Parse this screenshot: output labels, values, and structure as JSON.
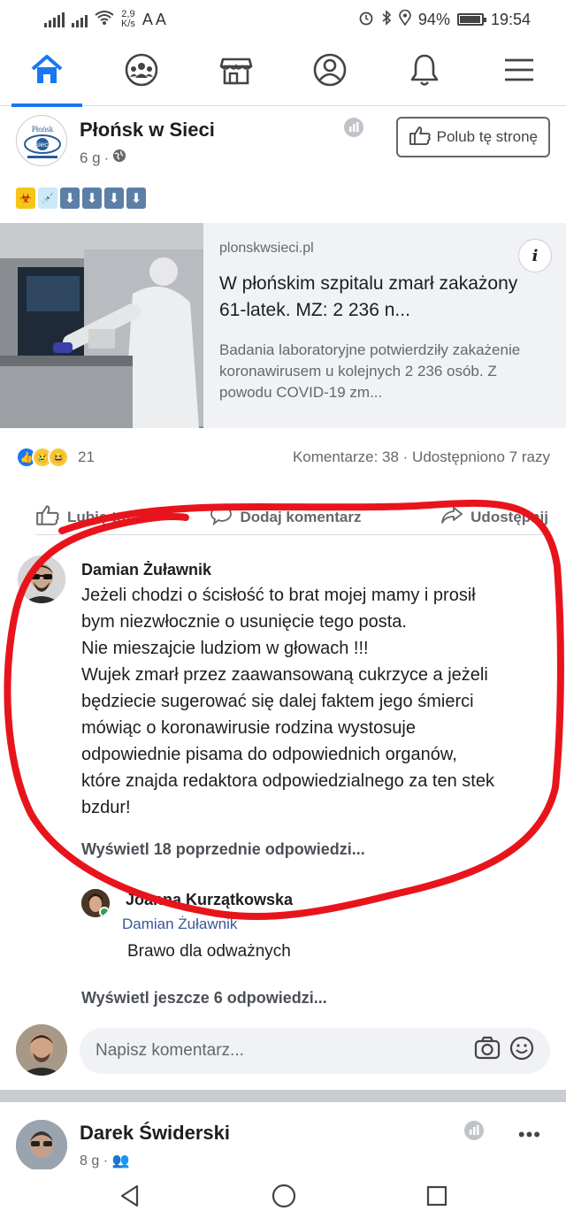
{
  "status_bar": {
    "speed": "2,9",
    "speed_unit": "K/s",
    "font_size_glyphs": "A A",
    "battery_level": "94%",
    "battery_fraction": 0.94,
    "time": "19:54"
  },
  "nav": {
    "items": [
      "home-icon",
      "groups-icon",
      "marketplace-icon",
      "profile-icon",
      "notifications-icon",
      "menu-icon"
    ],
    "active": "home-icon",
    "accent_color": "#1877f2"
  },
  "post": {
    "page_logo_text": "Płońsk",
    "page_logo_text2": "sieci",
    "page_name": "Płońsk w Sieci",
    "time": "6 g",
    "like_page_label": "Polub tę stronę",
    "link": {
      "domain": "plonskwsieci.pl",
      "title": "W płońskim szpitalu zmarł zakażony 61-latek. MZ: 2 236 n...",
      "description": "Badania laboratoryjne potwierdziły zakażenie koronawirusem u kolejnych 2 236 osób. Z powodu COVID-19 zm..."
    },
    "reaction_count": "21",
    "comments_shares": "Komentarze: 38 · Udostępniono 7 razy",
    "actions": {
      "like": "Lubię to!",
      "comment": "Dodaj komentarz",
      "share": "Udostępnij"
    }
  },
  "comment": {
    "author": "Damian Żuławnik",
    "text": "Jeżeli chodzi o ścisłość to brat mojej mamy i prosił\nbym niezwłocznie o usunięcie tego posta.\nNie mieszajcie ludziom w głowach !!!\nWujek zmarł przez zaawansowaną cukrzyce a jeżeli\nbędziecie sugerować się dalej faktem jego śmierci\nmówiąc o koronawirusie rodzina wystosuje\nodpowiednie pisama do odpowiednich organów,\nktóre znajda redaktora odpowiedzialnego za ten stek\nbzdur!",
    "view_previous": "Wyświetl 18 poprzednie odpowiedzi..."
  },
  "reply": {
    "author": "Joanna Kurzątkowska",
    "tag": "Damian Żuławnik",
    "text": "Brawo dla odważnych",
    "view_more": "Wyświetl jeszcze 6 odpowiedzi..."
  },
  "composer": {
    "placeholder": "Napisz komentarz..."
  },
  "next_post": {
    "author": "Darek Świderski",
    "time": "8 g"
  },
  "annotation_color": "#e8141c"
}
